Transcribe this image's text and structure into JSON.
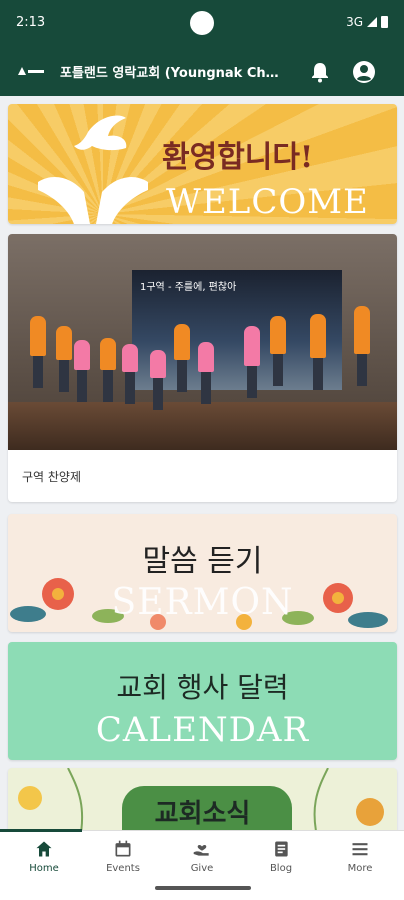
{
  "status_bar": {
    "time": "2:13",
    "network": "3G"
  },
  "app_bar": {
    "title": "포틀랜드 영락교회 (Youngnak Ch…"
  },
  "banners": {
    "welcome": {
      "korean": "환영합니다!",
      "english": "WELCOME"
    },
    "photo": {
      "screen_text": "1구역 - 주를에, 편찮아",
      "caption": "구역 찬양제"
    },
    "sermon": {
      "korean": "말씀 듣기",
      "english": "SERMON"
    },
    "calendar": {
      "korean": "교회 행사 달력",
      "english": "CALENDAR"
    },
    "news": {
      "korean": "교회소식"
    }
  },
  "bottom_nav": {
    "items": [
      {
        "label": "Home",
        "icon": "home-icon"
      },
      {
        "label": "Events",
        "icon": "calendar-icon"
      },
      {
        "label": "Give",
        "icon": "give-icon"
      },
      {
        "label": "Blog",
        "icon": "blog-icon"
      },
      {
        "label": "More",
        "icon": "menu-icon"
      }
    ],
    "active": "Home"
  },
  "colors": {
    "primary": "#174a3a",
    "welcome": "#f4bd45",
    "calendar": "#8ddcb5",
    "sermon": "#f8ebe0"
  }
}
